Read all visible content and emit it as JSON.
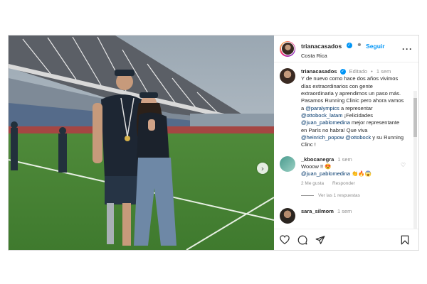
{
  "post": {
    "author": {
      "username": "trianacasados",
      "follow_label": "Seguir",
      "location": "Costa Rica"
    },
    "caption": {
      "username": "trianacasados",
      "edited": "Editado",
      "time": "1 sem",
      "text_1": "Y de nuevo como hace dos años vivimos días extraordinarios con gente extraordinaria y aprendimos un paso más. Pasamos Running Clinic pero ahora vamos a ",
      "mention_paralympics": "@paralympics",
      "text_2": " a representar ",
      "mention_ottobock_latam": "@ottobock_latam",
      "text_3": " ¡Felicidades ",
      "mention_juan": "@juan_pablomedina",
      "text_4": " mejor representante en París no habra! Que viva ",
      "mention_heinrich": "@heinrich_popow",
      "text_5": " ",
      "mention_ottobock": "@ottobock",
      "text_6": " y su Running Clinc !"
    },
    "comments": [
      {
        "username": "_kbocanegra",
        "time": "1 sem",
        "text": "Wooow !! 😍",
        "mention": "@juan_pablomedina",
        "emojis": "👏🔥😱",
        "likes": "2 Me gusta",
        "reply_label": "Responder",
        "replies_label": "Ver las 1 respuestas"
      },
      {
        "username": "sara_silmom",
        "time": "1 sem"
      }
    ]
  },
  "icons": {
    "like": "heart-icon",
    "comment": "comment-icon",
    "share": "share-icon",
    "save": "bookmark-icon",
    "more": "more-icon",
    "next": "chevron-right-icon"
  },
  "colors": {
    "accent": "#0095f6",
    "link": "#00376b",
    "muted": "#8e8e8e"
  },
  "more_glyph": "···",
  "next_glyph": "›",
  "verified_glyph": "✓",
  "small_heart_glyph": "♡",
  "separator": "•"
}
